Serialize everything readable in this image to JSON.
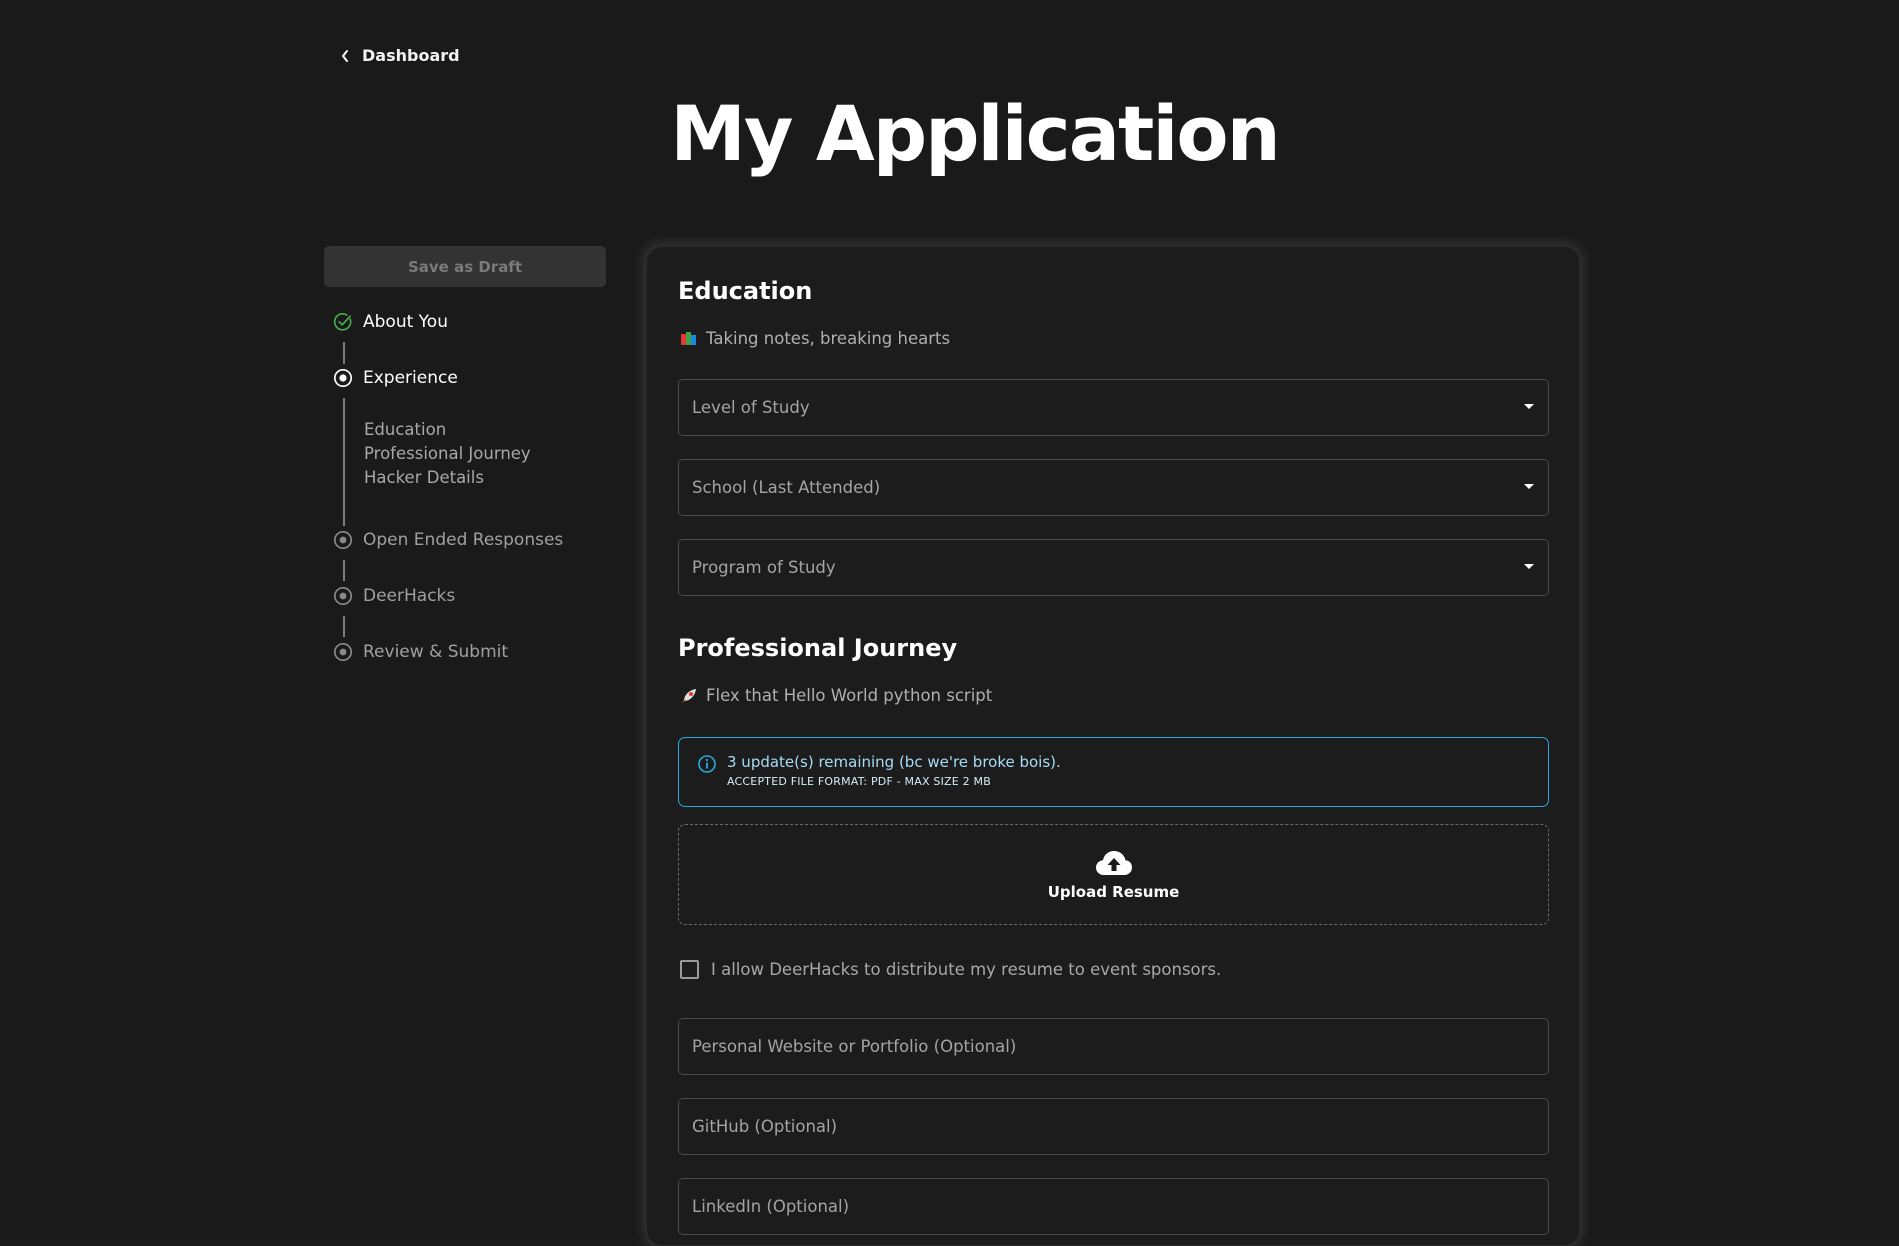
{
  "nav": {
    "back_label": "Dashboard"
  },
  "page": {
    "title": "My Application"
  },
  "sidebar": {
    "draft_label": "Save as Draft",
    "steps": [
      {
        "label": "About You",
        "state": "complete"
      },
      {
        "label": "Experience",
        "state": "current"
      },
      {
        "label": "Open Ended Responses",
        "state": "upcoming"
      },
      {
        "label": "DeerHacks",
        "state": "upcoming"
      },
      {
        "label": "Review & Submit",
        "state": "upcoming"
      }
    ],
    "substeps": [
      "Education",
      "Professional Journey",
      "Hacker Details"
    ]
  },
  "education": {
    "title": "Education",
    "subtitle_icon": "books-emoji",
    "subtitle": "Taking notes, breaking hearts",
    "level_placeholder": "Level of Study",
    "school_placeholder": "School (Last Attended)",
    "program_placeholder": "Program of Study"
  },
  "professional": {
    "title": "Professional Journey",
    "subtitle_icon": "rocket-emoji",
    "subtitle": "Flex that Hello World python script",
    "info_main": "3 update(s) remaining (bc we're broke bois).",
    "info_sub": "ACCEPTED FILE FORMAT: PDF - MAX SIZE 2 MB",
    "upload_label": "Upload Resume",
    "consent_label": "I allow DeerHacks to distribute my resume to event sponsors.",
    "consent_checked": false,
    "website_placeholder": "Personal Website or Portfolio (Optional)",
    "github_placeholder": "GitHub (Optional)",
    "linkedin_placeholder": "LinkedIn (Optional)"
  },
  "colors": {
    "background": "#1a1a1a",
    "card": "#1c1c1c",
    "info_accent": "#29a8e0",
    "complete": "#4caf50"
  }
}
